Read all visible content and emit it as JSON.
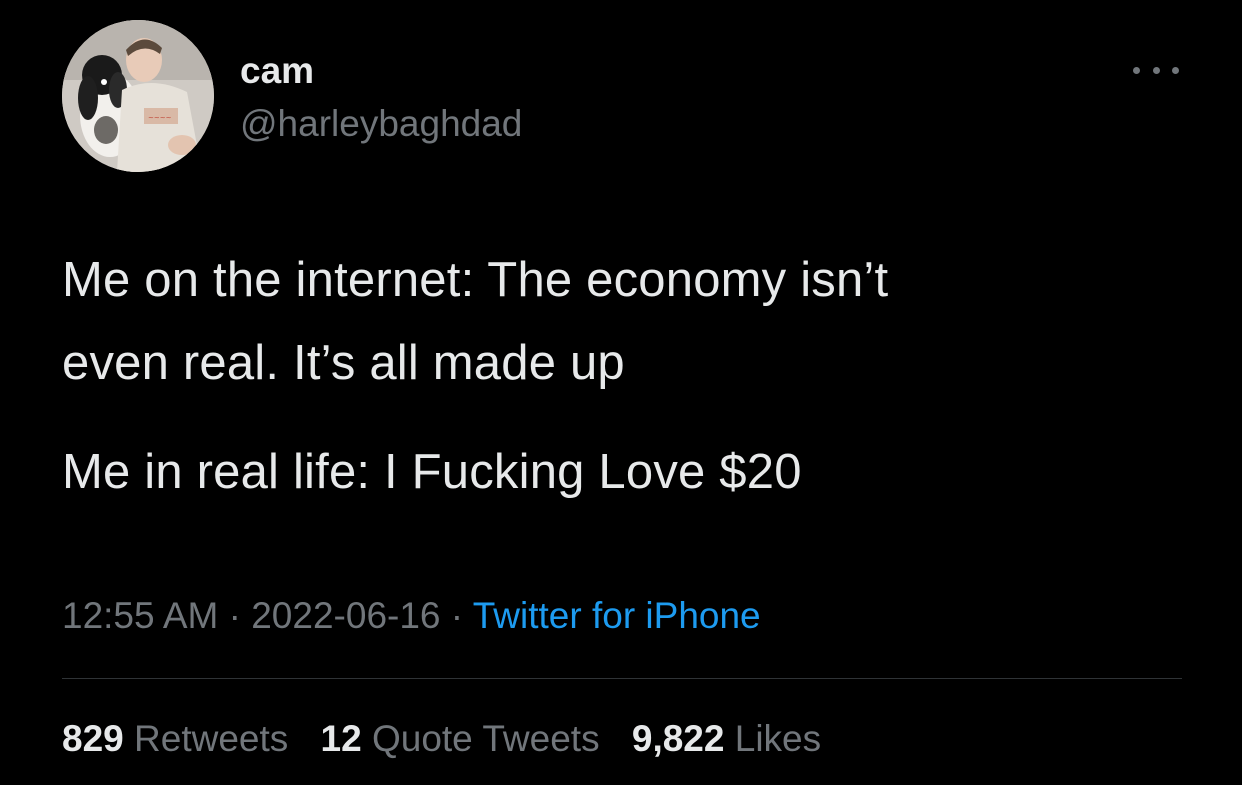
{
  "user": {
    "display_name": "cam",
    "handle": "@harleybaghdad",
    "avatar_icon": "profile-photo"
  },
  "more_icon": "more-horizontal-icon",
  "tweet": {
    "line1": "Me on the internet: The economy isn’t",
    "line2": "even real. It’s all made up",
    "line3": "Me in real life: I Fucking Love $20"
  },
  "meta": {
    "time": "12:55 AM",
    "separator": " · ",
    "date": "2022-06-16",
    "source": "Twitter for iPhone"
  },
  "stats": {
    "retweets_count": "829",
    "retweets_label": "Retweets",
    "quotes_count": "12",
    "quotes_label": "Quote Tweets",
    "likes_count": "9,822",
    "likes_label": "Likes"
  },
  "colors": {
    "background": "#000000",
    "primary_text": "#e7e9ea",
    "secondary_text": "#71767b",
    "link": "#1d9bf0",
    "divider": "#2f3336"
  }
}
